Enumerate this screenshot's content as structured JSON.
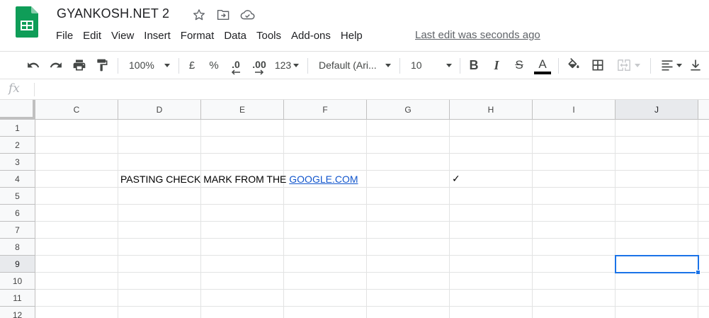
{
  "doc": {
    "title": "GYANKOSH.NET 2",
    "last_edit": "Last edit was seconds ago"
  },
  "menu": [
    "File",
    "Edit",
    "View",
    "Insert",
    "Format",
    "Data",
    "Tools",
    "Add-ons",
    "Help"
  ],
  "toolbar": {
    "zoom": "100%",
    "currency": "£",
    "percent": "%",
    "decrease_decimal": ".0",
    "increase_decimal": ".00",
    "more_formats": "123",
    "font": "Default (Ari...",
    "font_size": "10",
    "bold": "B",
    "italic": "I",
    "strikethrough": "S",
    "text_color": "A",
    "text_color_value": "#000000"
  },
  "formula_bar": {
    "fx": "fx",
    "value": ""
  },
  "columns": [
    "C",
    "D",
    "E",
    "F",
    "G",
    "H",
    "I",
    "J"
  ],
  "rows": [
    "1",
    "2",
    "3",
    "4",
    "5",
    "6",
    "7",
    "8",
    "9",
    "10",
    "11",
    "12"
  ],
  "selected_cell": {
    "column": "J",
    "row": "9"
  },
  "cells": {
    "D4_text": "PASTING CHECK MARK FROM THE ",
    "D4_link": "GOOGLE.COM",
    "H4": "✓"
  },
  "colors": {
    "brand_green": "#0F9D58",
    "selection_blue": "#1A73E8",
    "link_blue": "#1155CC"
  }
}
